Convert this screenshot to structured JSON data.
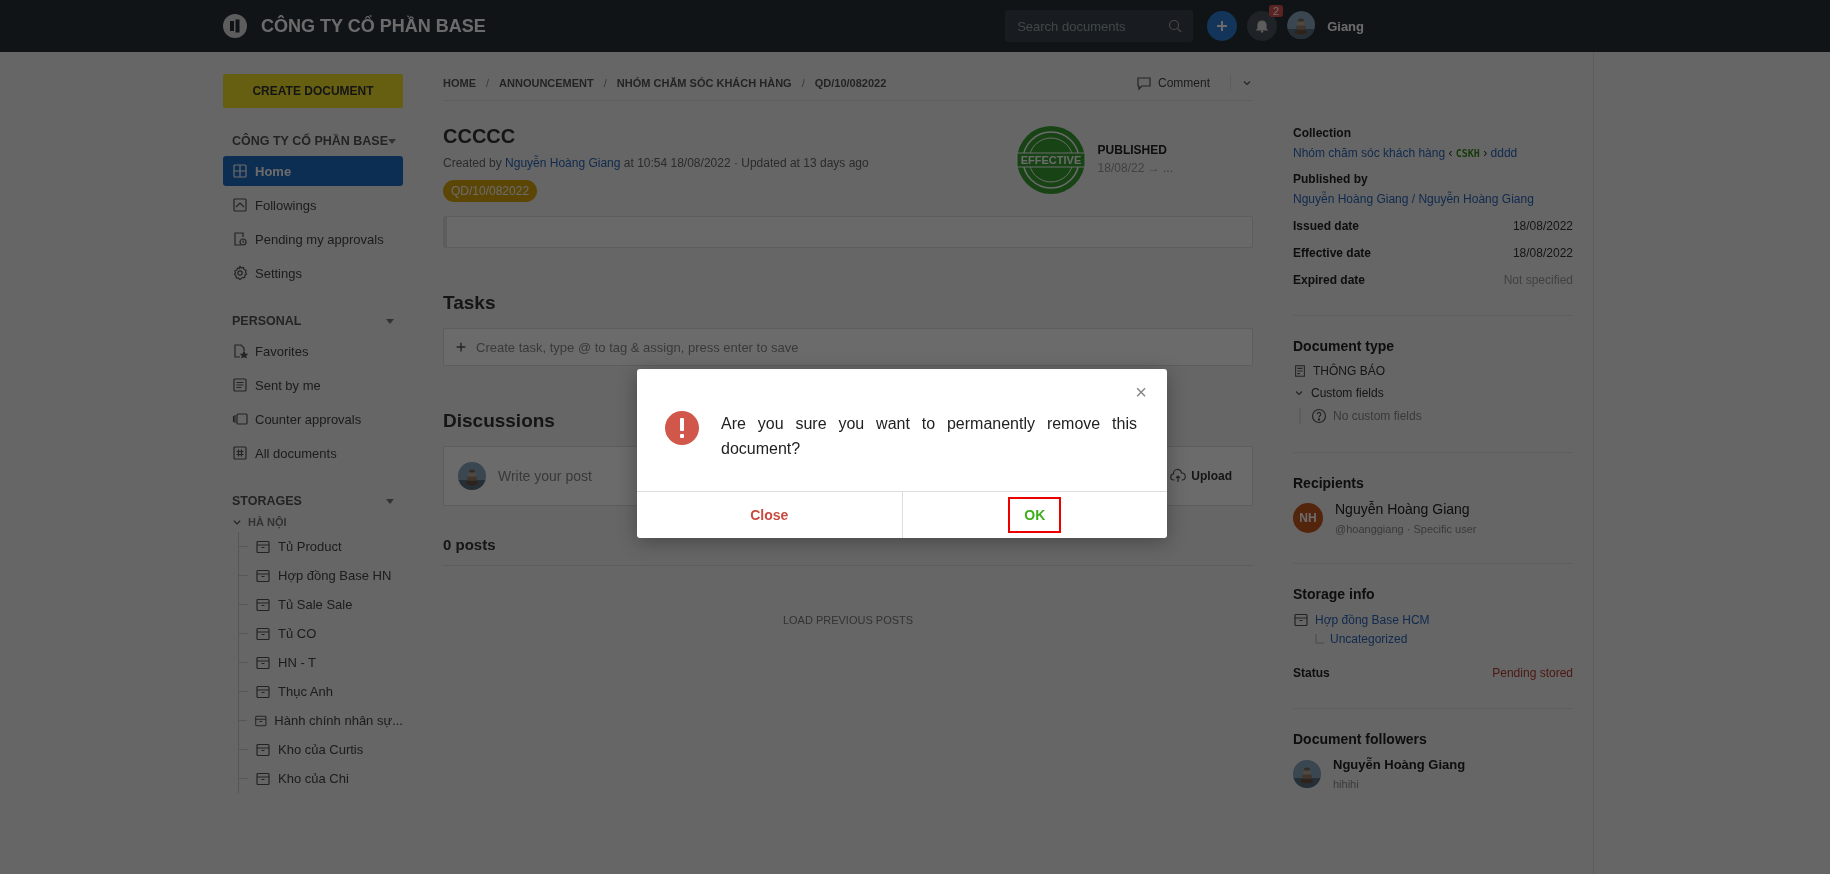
{
  "topbar": {
    "company": "CÔNG TY CỔ PHẦN BASE",
    "search": {
      "placeholder": "Search documents"
    },
    "notifications": "2",
    "user": "Giang"
  },
  "sidebar": {
    "create_button": "CREATE DOCUMENT",
    "sections": [
      {
        "title": "CÔNG TY CỔ PHẦN BASE",
        "items": [
          {
            "label": "Home",
            "kind": "home",
            "selected": true
          },
          {
            "label": "Followings",
            "kind": "followings",
            "selected": false
          },
          {
            "label": "Pending my approvals",
            "kind": "pending",
            "selected": false
          },
          {
            "label": "Settings",
            "kind": "settings",
            "selected": false
          }
        ]
      },
      {
        "title": "PERSONAL",
        "items": [
          {
            "label": "Favorites",
            "kind": "favorites",
            "selected": false
          },
          {
            "label": "Sent by me",
            "kind": "sent",
            "selected": false
          },
          {
            "label": "Counter approvals",
            "kind": "counter",
            "selected": false
          },
          {
            "label": "All documents",
            "kind": "all",
            "selected": false
          }
        ]
      }
    ],
    "storages": {
      "title": "STORAGES",
      "groups": [
        {
          "label": "HÀ NỘI",
          "expanded": true,
          "children": [
            {
              "label": "Tủ Product"
            },
            {
              "label": "Hợp đồng Base HN"
            },
            {
              "label": "Tủ Sale Sale"
            },
            {
              "label": "Tủ CO"
            },
            {
              "label": "HN - T"
            },
            {
              "label": "Thục Anh"
            },
            {
              "label": "Hành chính nhân sự..."
            },
            {
              "label": "Kho của Curtis"
            },
            {
              "label": "Kho của Chi"
            }
          ]
        }
      ]
    }
  },
  "breadcrumb": [
    "HOME",
    "ANNOUNCEMENT",
    "NHÓM CHĂM SÓC KHÁCH HÀNG",
    "QD/10/082022"
  ],
  "breadcrumb_separator": "/",
  "comment_button": "Comment",
  "document": {
    "title": "CCCCC",
    "meta_prefix": "Created by",
    "author": "Nguyễn Hoàng Giang",
    "meta_suffix": "at 10:54 18/08/2022 · Updated at 13 days ago",
    "tag": "QD/10/082022",
    "stamp": "EFFECTIVE",
    "status": "PUBLISHED",
    "dates": "18/08/22 → ..."
  },
  "tasks": {
    "title": "Tasks",
    "placeholder": "Create task, type @ to tag & assign, press enter to save"
  },
  "discussions": {
    "title": "Discussions",
    "placeholder": "Write your post",
    "upload": "Upload",
    "count": "0 posts",
    "load_more": "LOAD PREVIOUS POSTS"
  },
  "details": {
    "collection_label": "Collection",
    "collection": "Nhóm chăm sóc khách hàng",
    "collection_open": "‹",
    "collection_code": "CSKH",
    "collection_close": "›",
    "collection_sub": "dddd",
    "published_by_label": "Published by",
    "published_by": "Nguyễn Hoàng Giang / Nguyễn Hoàng Giang",
    "rows": [
      {
        "label": "Issued date",
        "value": "18/08/2022",
        "muted": false
      },
      {
        "label": "Effective date",
        "value": "18/08/2022",
        "muted": false
      },
      {
        "label": "Expired date",
        "value": "Not specified",
        "muted": true
      }
    ],
    "doc_type_title": "Document type",
    "doc_type": "THÔNG BÁO",
    "custom_fields": {
      "label": "Custom fields",
      "expanded": true,
      "empty": "No custom fields"
    },
    "recipients_title": "Recipients",
    "recipients": [
      {
        "initials": "NH",
        "name": "Nguyễn Hoàng Giang",
        "sub": "@hoanggiang · Specific user"
      }
    ],
    "storage_title": "Storage info",
    "storage": "Hợp đồng Base HCM",
    "storage_sub": "Uncategorized",
    "status_label": "Status",
    "status": "Pending stored",
    "followers_title": "Document followers",
    "followers": [
      {
        "name": "Nguyễn Hoàng Giang",
        "sub": "hihihi"
      }
    ]
  },
  "dialog": {
    "message": "Are you sure you want to permanently remove this document?",
    "close_icon": "×",
    "buttons": [
      {
        "label": "Close",
        "kind": "cancel",
        "highlighted": false
      },
      {
        "label": "OK",
        "kind": "confirm",
        "highlighted": true
      }
    ]
  }
}
